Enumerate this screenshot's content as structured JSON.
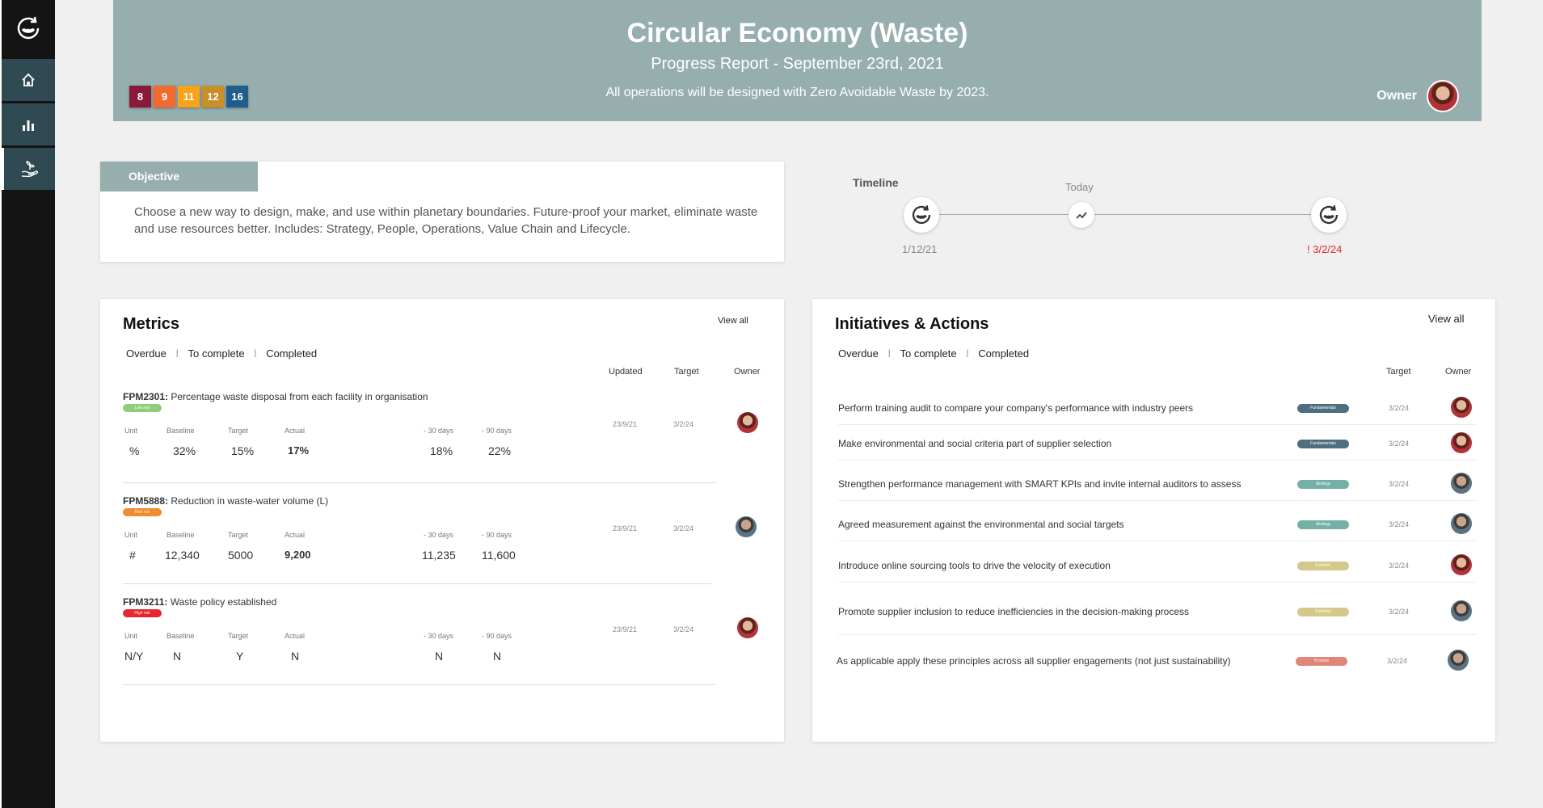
{
  "header": {
    "title": "Circular Economy (Waste)",
    "subtitle": "Progress Report - September 23rd, 2021",
    "description": "All operations will be designed with Zero Avoidable Waste by 2023.",
    "owner_label": "Owner",
    "sdgs": [
      {
        "label": "8",
        "color": "#8b1a3a"
      },
      {
        "label": "9",
        "color": "#f26a2e"
      },
      {
        "label": "11",
        "color": "#f9a31b"
      },
      {
        "label": "12",
        "color": "#c8902b"
      },
      {
        "label": "16",
        "color": "#1f5e8c"
      }
    ]
  },
  "sidebar": {
    "items": [
      {
        "icon": "home-icon"
      },
      {
        "icon": "bar-chart-icon"
      },
      {
        "icon": "hand-plant-icon"
      }
    ]
  },
  "objective": {
    "tab_label": "Objective",
    "text": "Choose a new way to design, make, and use within planetary boundaries. Future-proof your market, eliminate waste and use resources better. Includes: Strategy, People, Operations, Value Chain and Lifecycle."
  },
  "timeline": {
    "title": "Timeline",
    "today_label": "Today",
    "start_date": "1/12/21",
    "end_date": "! 3/2/24"
  },
  "metrics": {
    "title": "Metrics",
    "view_all": "View all",
    "tabs": [
      "Overdue",
      "To complete",
      "Completed"
    ],
    "columns": {
      "updated": "Updated",
      "target": "Target",
      "owner": "Owner"
    },
    "labels": {
      "unit": "Unit",
      "baseline": "Baseline",
      "target": "Target",
      "actual": "Actual",
      "d30": "- 30 days",
      "d90": "- 90 days"
    },
    "rows": [
      {
        "code": "FPM2301:",
        "name": "Percentage waste disposal from each facility in organisation",
        "risk": "Low risk",
        "risk_color": "#8fcf7a",
        "unit": "%",
        "baseline": "32%",
        "target": "15%",
        "actual": "17%",
        "d30": "18%",
        "d90": "22%",
        "updated": "23/9/21",
        "target_date": "3/2/24",
        "owner": "f"
      },
      {
        "code": "FPM5888:",
        "name": "Reduction in waste-water volume (L)",
        "risk": "Med risk",
        "risk_color": "#f28a2e",
        "unit": "#",
        "baseline": "12,340",
        "target": "5000",
        "actual": "9,200",
        "d30": "11,235",
        "d90": "11,600",
        "updated": "23/9/21",
        "target_date": "3/2/24",
        "owner": "m"
      },
      {
        "code": "FPM3211:",
        "name": "Waste policy established",
        "risk": "High risk",
        "risk_color": "#e8262e",
        "unit": "N/Y",
        "baseline": "N",
        "target": "Y",
        "actual": "N",
        "d30": "N",
        "d90": "N",
        "updated": "23/9/21",
        "target_date": "3/2/24",
        "owner": "f"
      }
    ]
  },
  "initiatives": {
    "title": "Initiatives & Actions",
    "view_all": "View all",
    "tabs": [
      "Overdue",
      "To complete",
      "Completed"
    ],
    "columns": {
      "target": "Target",
      "owner": "Owner"
    },
    "rows": [
      {
        "text": "Perform training audit to compare your company's performance with industry peers",
        "tag": "Fundamentals",
        "tag_color": "#4f6f80",
        "date": "3/2/24",
        "owner": "f"
      },
      {
        "text": "Make environmental and social criteria part of supplier selection",
        "tag": "Fundamentals",
        "tag_color": "#4f6f80",
        "date": "3/2/24",
        "owner": "f"
      },
      {
        "text": "Strengthen performance management with SMART KPIs and invite internal auditors to assess",
        "tag": "Strategy",
        "tag_color": "#74b0a8",
        "date": "3/2/24",
        "owner": "m"
      },
      {
        "text": "Agreed measurement against the environmental and social targets",
        "tag": "Strategy",
        "tag_color": "#74b0a8",
        "date": "3/2/24",
        "owner": "m"
      },
      {
        "text": "Introduce online sourcing tools to drive the velocity of execution",
        "tag": "Function",
        "tag_color": "#d4c88a",
        "date": "3/2/24",
        "owner": "f"
      },
      {
        "text": "Promote supplier inclusion to reduce inefficiencies in the decision-making process",
        "tag": "Function",
        "tag_color": "#d4c88a",
        "date": "3/2/24",
        "owner": "m"
      },
      {
        "text": "As applicable apply these principles across all supplier engagements (not just sustainability)",
        "tag": "Process",
        "tag_color": "#e0857a",
        "date": "3/2/24",
        "owner": "m"
      }
    ]
  }
}
